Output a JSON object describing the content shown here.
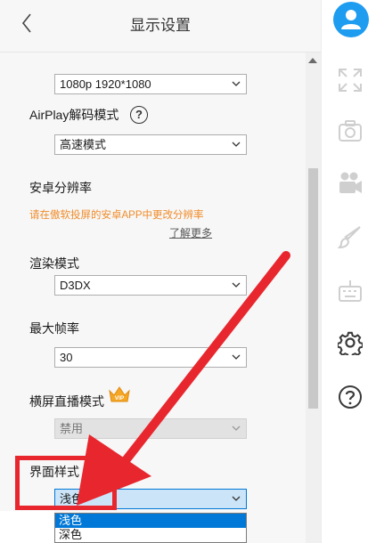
{
  "header": {
    "title": "显示设置"
  },
  "settings": {
    "resolution_select": {
      "value": "1080p 1920*1080"
    },
    "airplay": {
      "label": "AirPlay解码模式",
      "help_icon": "?",
      "value": "高速模式"
    },
    "android": {
      "label": "安卓分辨率",
      "hint": "请在傲软投屏的安卓APP中更改分辨率",
      "link": "了解更多"
    },
    "render": {
      "label": "渲染模式",
      "value": "D3DX"
    },
    "fps": {
      "label": "最大帧率",
      "value": "30"
    },
    "landscape": {
      "label": "横屏直播模式",
      "badge": "VIP",
      "value": "禁用"
    },
    "theme": {
      "label": "界面样式",
      "value": "浅色",
      "options": [
        "浅色",
        "深色"
      ]
    }
  },
  "sidebar": {
    "items": [
      {
        "icon": "user-icon"
      },
      {
        "icon": "fullscreen-icon"
      },
      {
        "icon": "camera-icon"
      },
      {
        "icon": "video-camera-icon"
      },
      {
        "icon": "brush-icon"
      },
      {
        "icon": "keyboard-icon"
      },
      {
        "icon": "gear-icon"
      },
      {
        "icon": "help-icon"
      }
    ]
  },
  "colors": {
    "accent": "#1e9cf0",
    "hint": "#f08c2a",
    "highlight": "#0078d7",
    "annotation": "#e8262e",
    "badge": "#f5a623"
  }
}
